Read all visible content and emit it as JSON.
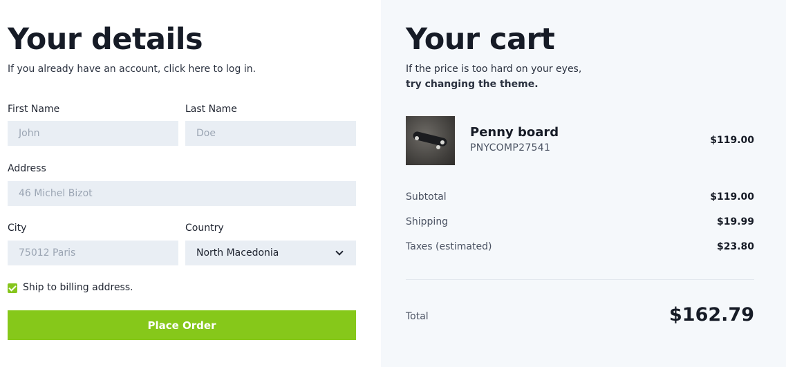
{
  "details": {
    "title": "Your details",
    "intro": "If you already have an account, click here to log in.",
    "first_name": {
      "label": "First Name",
      "placeholder": "John"
    },
    "last_name": {
      "label": "Last Name",
      "placeholder": "Doe"
    },
    "address": {
      "label": "Address",
      "placeholder": "46 Michel Bizot"
    },
    "city": {
      "label": "City",
      "placeholder": "75012 Paris"
    },
    "country": {
      "label": "Country",
      "selected": "North Macedonia"
    },
    "ship_billing": {
      "label": "Ship to billing address.",
      "checked": true
    },
    "place_order_label": "Place Order"
  },
  "cart": {
    "title": "Your cart",
    "intro_line1": "If the price is too hard on your eyes,",
    "intro_line2": "try changing the theme.",
    "item": {
      "name": "Penny board",
      "sku": "PNYCOMP27541",
      "price": "$119.00"
    },
    "subtotal": {
      "label": "Subtotal",
      "value": "$119.00"
    },
    "shipping": {
      "label": "Shipping",
      "value": "$19.99"
    },
    "taxes": {
      "label": "Taxes (estimated)",
      "value": "$23.80"
    },
    "total": {
      "label": "Total",
      "value": "$162.79"
    }
  },
  "colors": {
    "accent": "#86c81a",
    "cart_bg": "#f5f8fb",
    "field_bg": "#e9eef4"
  }
}
